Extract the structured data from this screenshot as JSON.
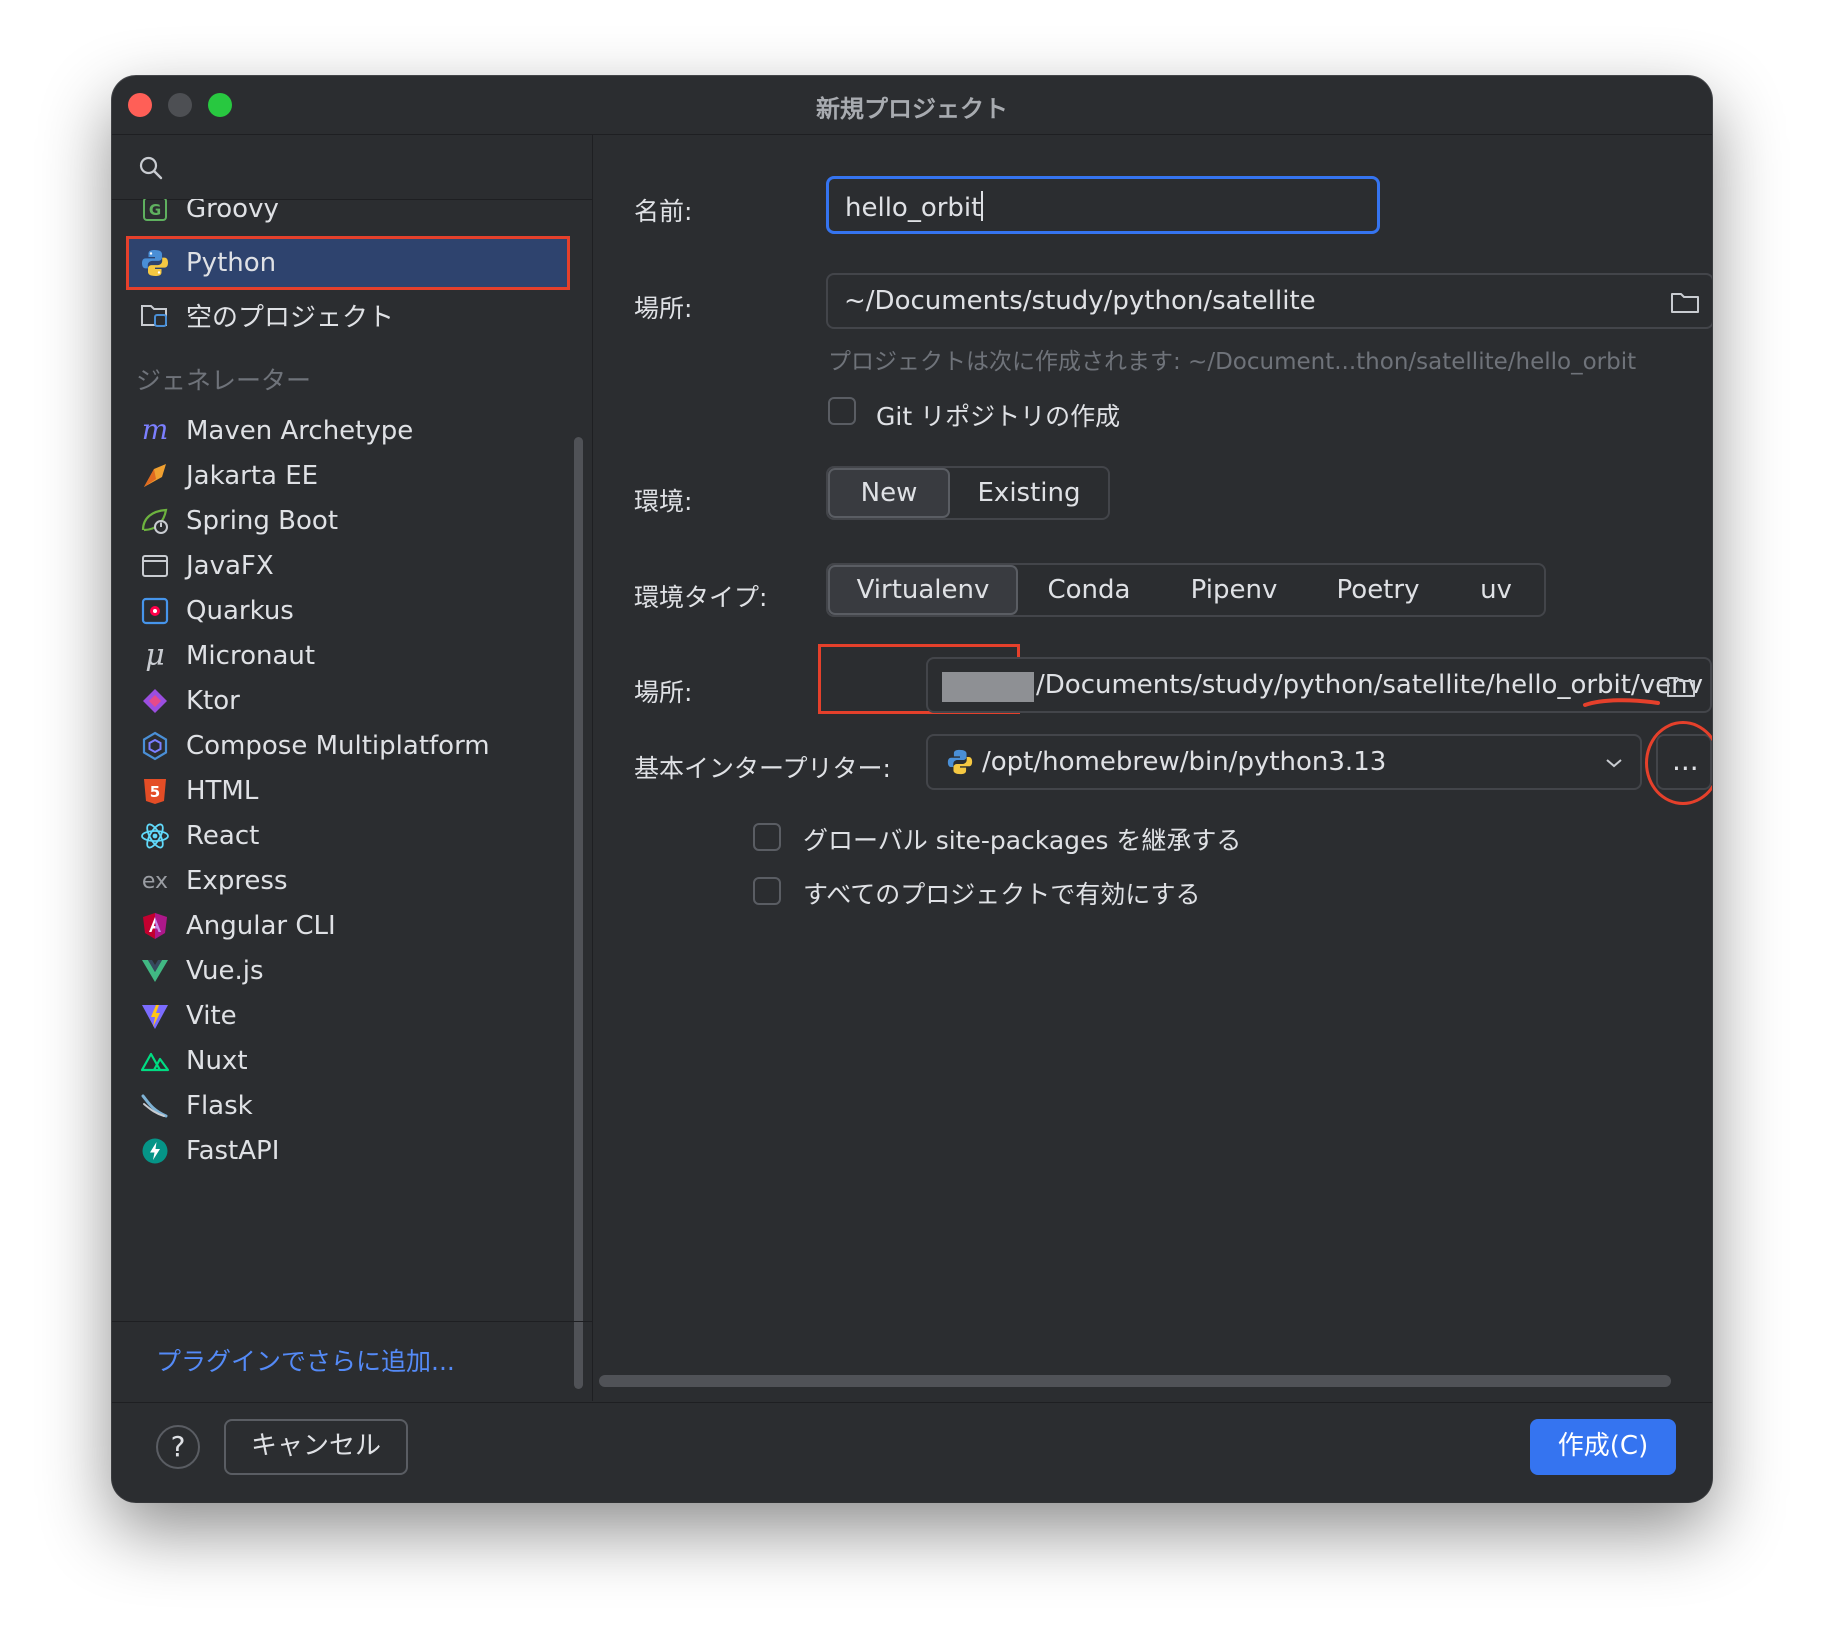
{
  "window": {
    "title": "新規プロジェクト"
  },
  "sidebar": {
    "items_top": [
      {
        "label": "Groovy",
        "icon": "groovy-icon"
      },
      {
        "label": "Python",
        "icon": "python-icon",
        "selected": true
      },
      {
        "label": "空のプロジェクト",
        "icon": "empty-project-icon"
      }
    ],
    "generators_label": "ジェネレーター",
    "generators": [
      {
        "label": "Maven Archetype",
        "icon": "maven-icon"
      },
      {
        "label": "Jakarta EE",
        "icon": "jakarta-icon"
      },
      {
        "label": "Spring Boot",
        "icon": "spring-boot-icon"
      },
      {
        "label": "JavaFX",
        "icon": "javafx-icon"
      },
      {
        "label": "Quarkus",
        "icon": "quarkus-icon"
      },
      {
        "label": "Micronaut",
        "icon": "micronaut-icon"
      },
      {
        "label": "Ktor",
        "icon": "ktor-icon"
      },
      {
        "label": "Compose Multiplatform",
        "icon": "compose-icon"
      },
      {
        "label": "HTML",
        "icon": "html5-icon"
      },
      {
        "label": "React",
        "icon": "react-icon"
      },
      {
        "label": "Express",
        "icon": "express-icon"
      },
      {
        "label": "Angular CLI",
        "icon": "angular-icon"
      },
      {
        "label": "Vue.js",
        "icon": "vue-icon"
      },
      {
        "label": "Vite",
        "icon": "vite-icon"
      },
      {
        "label": "Nuxt",
        "icon": "nuxt-icon"
      },
      {
        "label": "Flask",
        "icon": "flask-icon"
      },
      {
        "label": "FastAPI",
        "icon": "fastapi-icon"
      }
    ],
    "plugin_link": "プラグインでさらに追加..."
  },
  "form": {
    "name_label": "名前:",
    "name_value": "hello_orbit",
    "location_label": "場所:",
    "location_value": "~/Documents/study/python/satellite",
    "location_hint": "プロジェクトは次に作成されます: ~/Document...thon/satellite/hello_orbit",
    "git_label": "Git リポジトリの作成",
    "env_label": "環境:",
    "env_options": [
      "New",
      "Existing"
    ],
    "env_selected": "New",
    "env_type_label": "環境タイプ:",
    "env_type_options": [
      "Virtualenv",
      "Conda",
      "Pipenv",
      "Poetry",
      "uv"
    ],
    "env_type_selected": "Virtualenv",
    "venv_location_label": "場所:",
    "venv_location_value": "/Documents/study/python/satellite/hello_orbit/venv",
    "interpreter_label": "基本インタープリター:",
    "interpreter_value": "/opt/homebrew/bin/python3.13",
    "browse_label": "...",
    "inherit_label": "グローバル site-packages を継承する",
    "all_projects_label": "すべてのプロジェクトで有効にする"
  },
  "footer": {
    "help_label": "?",
    "cancel_label": "キャンセル",
    "create_label": "作成(C)"
  },
  "colors": {
    "accent": "#3574f0",
    "highlight": "#e5402b",
    "background": "#2b2d30",
    "selection": "#2e436e"
  }
}
